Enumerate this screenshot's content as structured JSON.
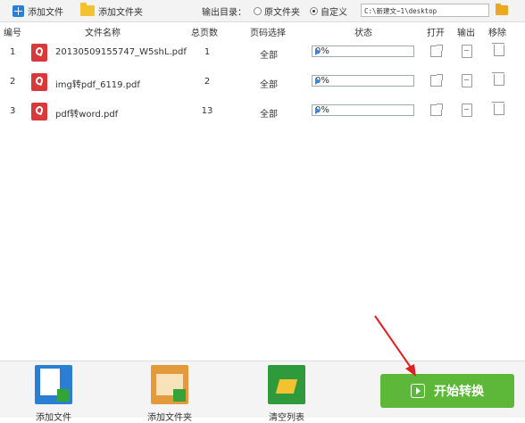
{
  "toolbar": {
    "add_file": "添加文件",
    "add_folder": "添加文件夹",
    "output_dir_label": "输出目录：",
    "radio_source": "原文件夹",
    "radio_custom": "自定义",
    "path_value": "C:\\新建文~1\\desktop"
  },
  "table": {
    "headers": {
      "num": "编号",
      "filename": "文件名称",
      "pages": "总页数",
      "range": "页码选择",
      "status": "状态",
      "open": "打开",
      "output": "输出",
      "remove": "移除"
    },
    "rows": [
      {
        "num": "1",
        "filename": "20130509155747_W5shL.pdf",
        "pages": "1",
        "range": "全部",
        "progress": "0%"
      },
      {
        "num": "2",
        "filename": "img转pdf_6119.pdf",
        "pages": "2",
        "range": "全部",
        "progress": "0%"
      },
      {
        "num": "3",
        "filename": "pdf转word.pdf",
        "pages": "13",
        "range": "全部",
        "progress": "0%"
      }
    ]
  },
  "bottom": {
    "add_file": "添加文件",
    "add_folder": "添加文件夹",
    "clear_list": "清空列表",
    "start": "开始转换"
  },
  "colors": {
    "start_button": "#5db83a",
    "arrow": "#e02020",
    "pdf_icon": "#d9393a"
  }
}
